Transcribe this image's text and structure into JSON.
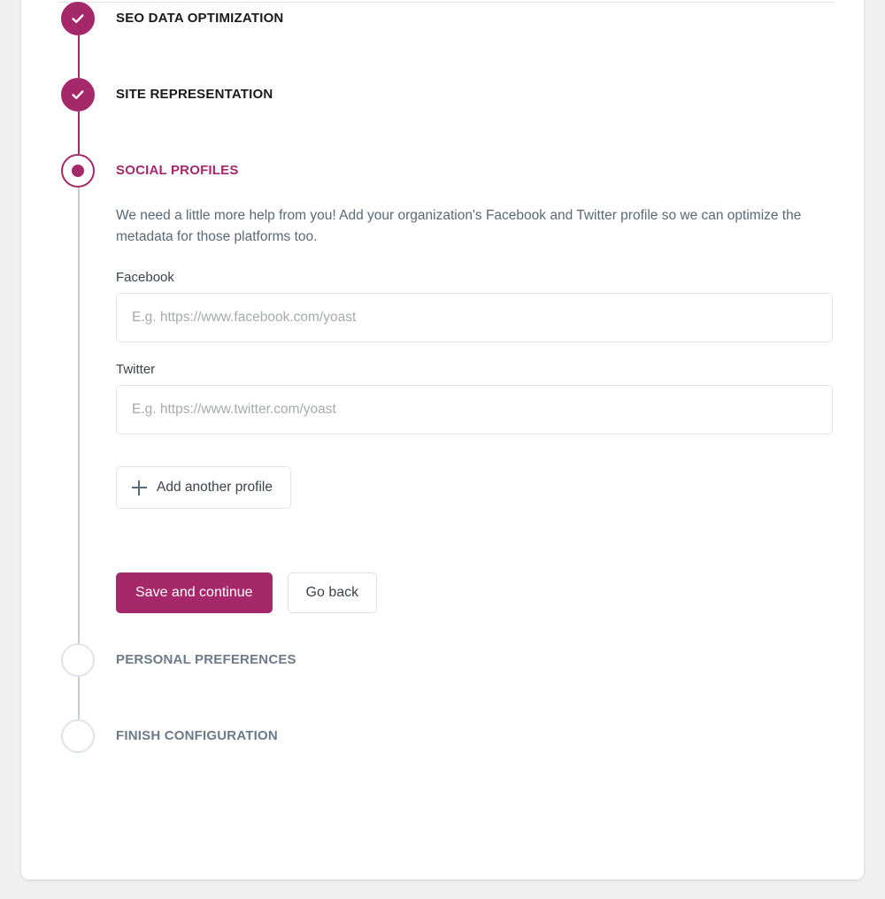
{
  "card": {
    "divider": true
  },
  "steps": [
    {
      "id": "seo-data-optimization",
      "title": "SEO DATA OPTIMIZATION",
      "state": "done"
    },
    {
      "id": "site-representation",
      "title": "SITE REPRESENTATION",
      "state": "done"
    },
    {
      "id": "social-profiles",
      "title": "SOCIAL PROFILES",
      "state": "active"
    },
    {
      "id": "personal-preferences",
      "title": "PERSONAL PREFERENCES",
      "state": "pending"
    },
    {
      "id": "finish-configuration",
      "title": "FINISH CONFIGURATION",
      "state": "pending"
    }
  ],
  "social": {
    "description": "We need a little more help from you! Add your organization's Facebook and Twitter profile so we can optimize the metadata for those platforms too.",
    "facebook": {
      "label": "Facebook",
      "value": "",
      "placeholder": "E.g. https://www.facebook.com/yoast"
    },
    "twitter": {
      "label": "Twitter",
      "value": "",
      "placeholder": "E.g. https://www.twitter.com/yoast"
    },
    "add_another_label": "Add another profile",
    "add_another_icon": "plus-icon",
    "save_label": "Save and continue",
    "go_back_label": "Go back"
  },
  "colors": {
    "accent": "#a4286a",
    "page_background": "#f0f0f1",
    "card_background": "#ffffff",
    "muted_text": "#5b6974",
    "pending_text": "#6c7a89",
    "border": "#e2e4e7"
  }
}
